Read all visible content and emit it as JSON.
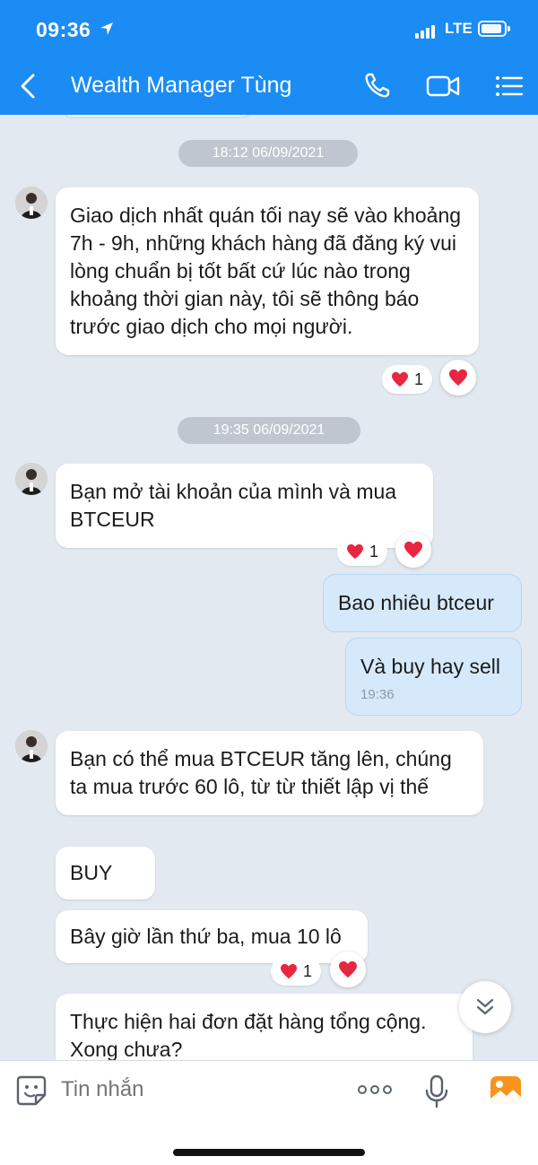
{
  "status_bar": {
    "time": "09:36",
    "network": "LTE"
  },
  "header": {
    "title": "Wealth Manager Tùng"
  },
  "messages": [
    {
      "type": "time",
      "text": "18:12 06/09/2021"
    },
    {
      "type": "incoming",
      "text": "Giao dịch nhất quán tối nay sẽ vào khoảng 7h - 9h, những khách hàng đã đăng ký vui lòng chuẩn bị tốt bất cứ lúc nào trong khoảng thời gian này, tôi sẽ thông báo trước giao dịch cho mọi người.",
      "reaction_count": "1"
    },
    {
      "type": "time",
      "text": "19:35 06/09/2021"
    },
    {
      "type": "incoming",
      "text": "Bạn mở tài khoản của mình và mua BTCEUR",
      "reaction_count": "1"
    },
    {
      "type": "outgoing",
      "text": "Bao nhiêu btceur"
    },
    {
      "type": "outgoing",
      "text": "Và buy hay sell",
      "time": "19:36"
    },
    {
      "type": "incoming",
      "text": "Bạn có thể mua BTCEUR tăng lên, chúng ta mua trước 60 lô, từ từ thiết lập vị thế"
    },
    {
      "type": "incoming",
      "text": "BUY"
    },
    {
      "type": "incoming",
      "text": "Bây giờ lần thứ ba, mua 10 lô",
      "reaction_count": "1"
    },
    {
      "type": "incoming",
      "text": "Thực hiện hai đơn đặt hàng tổng cộng. Xong chưa?"
    }
  ],
  "composer": {
    "placeholder": "Tin nhắn"
  },
  "colors": {
    "header": "#1a8cf3",
    "background": "#e2e9f1",
    "outgoing_bubble": "#d6e9fb",
    "heart": "#e8263f"
  }
}
